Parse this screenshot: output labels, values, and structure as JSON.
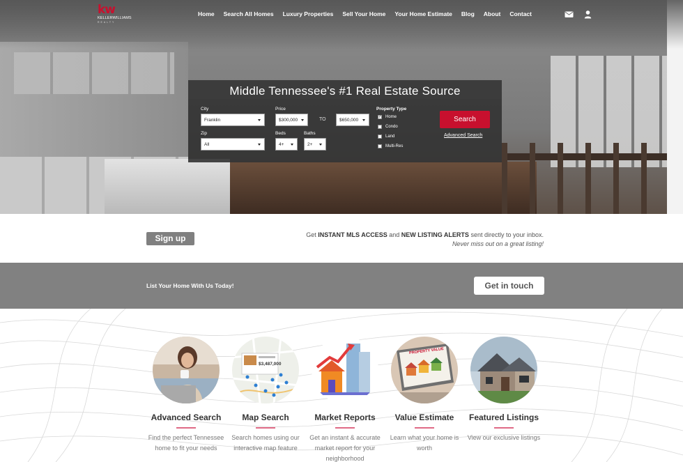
{
  "brand": {
    "logo_mark": "kw",
    "logo_name": "KELLERWILLIAMS",
    "logo_sub": "REALTY",
    "accent_color": "#c8102e"
  },
  "nav": {
    "items": [
      "Home",
      "Search All Homes",
      "Luxury Properties",
      "Sell Your Home",
      "Your Home Estimate",
      "Blog",
      "About",
      "Contact"
    ],
    "icons": [
      "envelope-icon",
      "user-icon"
    ]
  },
  "search": {
    "title": "Middle Tennessee's #1 Real Estate Source",
    "city_label": "City",
    "city_value": "Franklin",
    "zip_label": "Zip",
    "zip_value": "All",
    "price_label": "Price",
    "price_min": "$300,000",
    "price_to": "TO",
    "price_max": "$650,000",
    "beds_label": "Beds",
    "beds_value": "4+",
    "baths_label": "Baths",
    "baths_value": "2+",
    "property_type_label": "Property Type",
    "property_types": [
      {
        "label": "Home",
        "checked": true
      },
      {
        "label": "Condo",
        "checked": false
      },
      {
        "label": "Land",
        "checked": false
      },
      {
        "label": "Multi-Res",
        "checked": false
      }
    ],
    "search_button": "Search",
    "advanced_link": "Advanced Search"
  },
  "signup": {
    "button": "Sign up",
    "text_pre": "Get ",
    "text_b1": "INSTANT MLS ACCESS",
    "text_mid": " and ",
    "text_b2": "NEW LISTING ALERTS",
    "text_post": " sent directly to your inbox.",
    "subtext": "Never miss out on a great listing!"
  },
  "list_home": {
    "text": "List Your Home With Us Today!",
    "button": "Get in touch"
  },
  "features": [
    {
      "title": "Advanced Search",
      "desc": "Find the perfect Tennessee home to fit your needs"
    },
    {
      "title": "Map Search",
      "desc": "Search homes using our interactive map feature",
      "card_price": "$3,487,000"
    },
    {
      "title": "Market Reports",
      "desc": "Get an instant & accurate market report for your neighborhood"
    },
    {
      "title": "Value Estimate",
      "desc": "Learn what your home is worth",
      "screen_text": "PROPERTY VALUE"
    },
    {
      "title": "Featured Listings",
      "desc": "View our exclusive listings"
    }
  ]
}
